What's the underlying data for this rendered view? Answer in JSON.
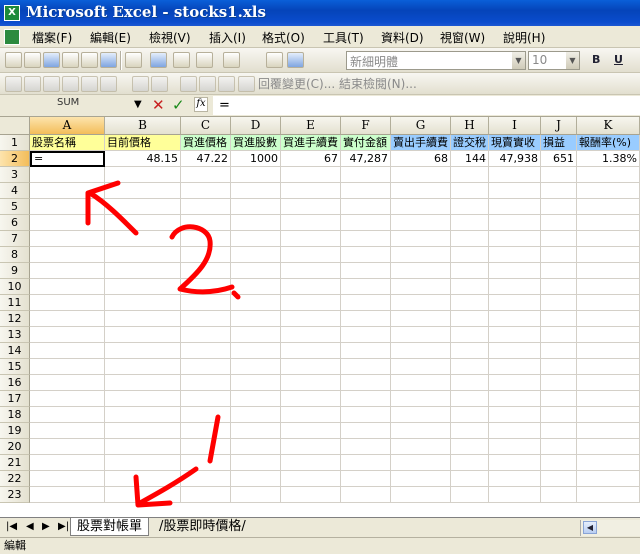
{
  "window": {
    "title": "Microsoft Excel - stocks1.xls"
  },
  "menu": [
    "檔案(F)",
    "編輯(E)",
    "檢視(V)",
    "插入(I)",
    "格式(O)",
    "工具(T)",
    "資料(D)",
    "視窗(W)",
    "說明(H)"
  ],
  "toolbar": {
    "font_name": "新細明體",
    "font_size": "10",
    "bold": "B",
    "underline": "U",
    "review_text": "回覆變更(C)... 結束檢閱(N)..."
  },
  "formula_bar": {
    "name_box": "SUM",
    "cancel": "✕",
    "enter": "✓",
    "fx": "fx",
    "content": "="
  },
  "grid": {
    "columns": [
      "A",
      "B",
      "C",
      "D",
      "E",
      "F",
      "G",
      "H",
      "I",
      "J",
      "K"
    ],
    "rows": [
      "1",
      "2",
      "3",
      "4",
      "5",
      "6",
      "7",
      "8",
      "9",
      "10",
      "11",
      "12",
      "13",
      "14",
      "15",
      "16",
      "17",
      "18",
      "19",
      "20",
      "21",
      "22",
      "23"
    ],
    "header_row": [
      "股票名稱",
      "目前價格",
      "買進價格",
      "買進股數",
      "買進手續費",
      "實付金額",
      "賣出手續費",
      "證交稅",
      "現賣實收",
      "損益",
      "報酬率(%)"
    ],
    "data_row": [
      "=",
      "48.15",
      "47.22",
      "1000",
      "67",
      "47,287",
      "68",
      "144",
      "47,938",
      "651",
      "1.38%"
    ]
  },
  "sheets": [
    "股票對帳單",
    "股票即時價格"
  ],
  "status": "編輯",
  "colors": {
    "annotation": "#ff0000",
    "header_yellow": "#ffff99",
    "header_green": "#ccffcc",
    "header_blue": "#99ccff"
  }
}
